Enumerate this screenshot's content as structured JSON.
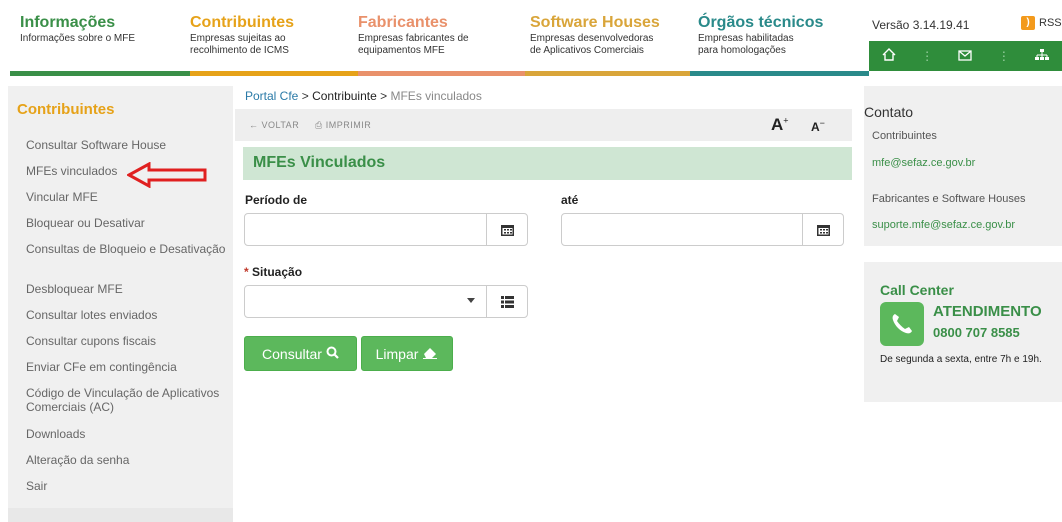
{
  "nav": [
    {
      "title": "Informações",
      "sub1": "Informações sobre o MFE",
      "sub2": "",
      "color": "#3a8f48"
    },
    {
      "title": "Contribuintes",
      "sub1": "Empresas sujeitas ao",
      "sub2": "recolhimento de ICMS",
      "color": "#e6a219"
    },
    {
      "title": "Fabricantes",
      "sub1": "Empresas fabricantes de",
      "sub2": "equipamentos MFE",
      "color": "#e9916b"
    },
    {
      "title": "Software Houses",
      "sub1": "Empresas desenvolvedoras",
      "sub2": "de Aplicativos Comerciais",
      "color": "#d9a53a"
    },
    {
      "title": "Órgãos técnicos",
      "sub1": "Empresas habilitadas",
      "sub2": "para homologações",
      "color": "#2a8a8a"
    }
  ],
  "versao": "Versão 3.14.19.41",
  "rss": "RSS",
  "sidebar": {
    "heading": "Contribuintes",
    "items": [
      "Consultar Software House",
      "MFEs vinculados",
      "Vincular MFE",
      "Bloquear ou Desativar",
      "Consultas de Bloqueio e Desativação",
      "Desbloquear MFE",
      "Consultar lotes enviados",
      "Consultar cupons fiscais",
      "Enviar CFe em contingência",
      "Código de Vinculação de Aplicativos Comerciais (AC)",
      "Downloads",
      "Alteração da senha",
      "Sair"
    ]
  },
  "breadcrumb": {
    "root": "Portal Cfe",
    "sep1": ">",
    "mid": "Contribuinte",
    "sep2": ">",
    "current": "MFEs vinculados"
  },
  "toolbar": {
    "voltar": "VOLTAR",
    "imprimir": "IMPRIMIR",
    "font_up": "A",
    "font_down": "A"
  },
  "section_title": "MFEs Vinculados",
  "form": {
    "periodo_label": "Período de",
    "ate_label": "até",
    "situacao_label": "Situação",
    "required_mark": "*",
    "periodo_value": "",
    "ate_value": "",
    "situacao_value": ""
  },
  "buttons": {
    "consultar": "Consultar",
    "limpar": "Limpar"
  },
  "contato": {
    "heading": "Contato",
    "contribuintes_label": "Contribuintes",
    "contribuintes_email": "mfe@sefaz.ce.gov.br",
    "fabricantes_label": "Fabricantes e Software Houses",
    "fabricantes_email": "suporte.mfe@sefaz.ce.gov.br"
  },
  "callcenter": {
    "title": "Call Center",
    "atendimento": "ATENDIMENTO",
    "phone": "0800 707 8585",
    "hours": "De segunda a sexta, entre 7h e 19h."
  },
  "colors": {
    "accent_green": "#2f8d3b",
    "sidebar_bg": "#f0f0f0",
    "annotation_arrow": "#e02020"
  }
}
